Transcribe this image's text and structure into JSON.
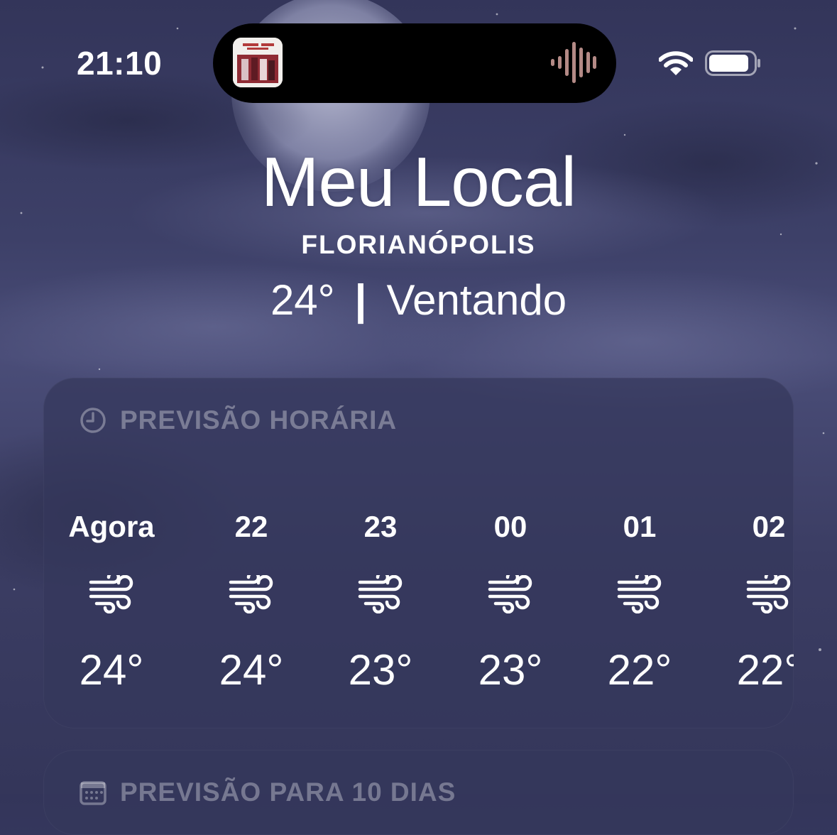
{
  "status_bar": {
    "time": "21:10",
    "icons": [
      "wifi-icon",
      "battery-icon"
    ]
  },
  "dynamic_island": {
    "activity": "now-playing",
    "icons": [
      "album-art",
      "waveform-icon"
    ],
    "waveform_color": "#b48a86"
  },
  "header": {
    "title": "Meu Local",
    "city": "FLORIANÓPOLIS",
    "temperature": "24°",
    "separator": "|",
    "condition": "Ventando"
  },
  "hourly": {
    "title": "PREVISÃO HORÁRIA",
    "icon": "clock-icon",
    "hours": [
      {
        "label": "Agora",
        "icon": "wind-icon",
        "temp": "24°"
      },
      {
        "label": "22",
        "icon": "wind-icon",
        "temp": "24°"
      },
      {
        "label": "23",
        "icon": "wind-icon",
        "temp": "23°"
      },
      {
        "label": "00",
        "icon": "wind-icon",
        "temp": "23°"
      },
      {
        "label": "01",
        "icon": "wind-icon",
        "temp": "22°"
      },
      {
        "label": "02",
        "icon": "wind-icon",
        "temp": "22°"
      }
    ]
  },
  "daily": {
    "title": "PREVISÃO PARA 10 DIAS",
    "icon": "calendar-icon"
  },
  "colors": {
    "card_background": "#34375c",
    "header_text": "rgba(255,255,255,0.33)",
    "text": "#ffffff"
  }
}
